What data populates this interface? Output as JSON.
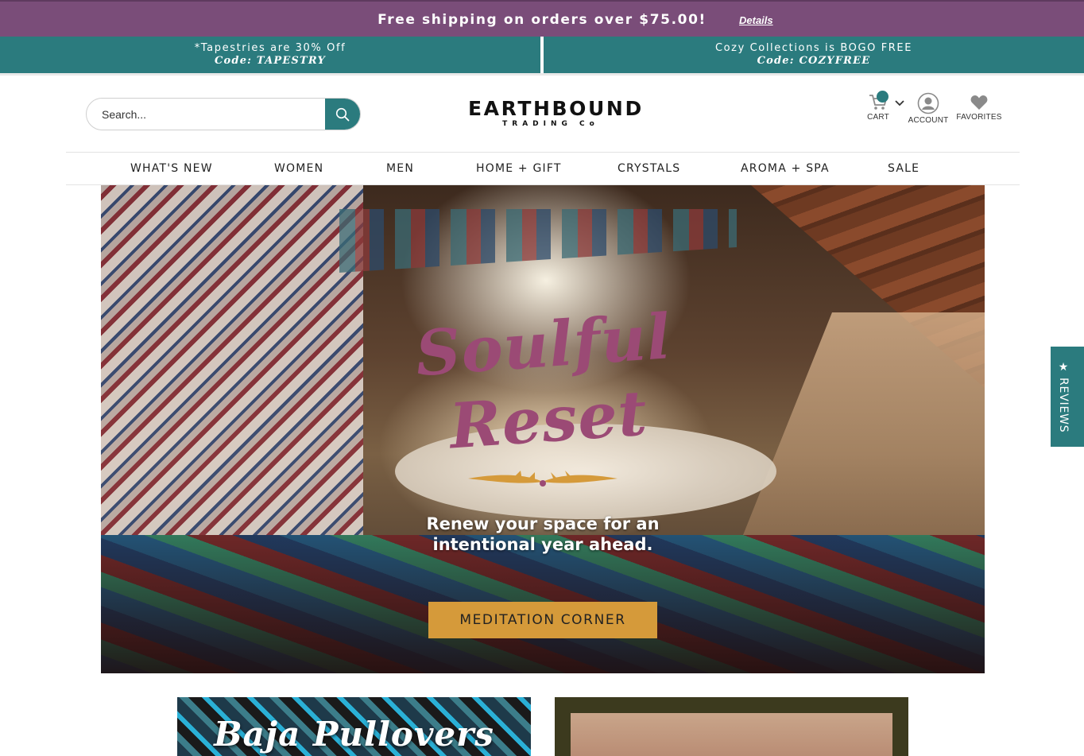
{
  "promo": {
    "text": "Free shipping on orders over $75.00!",
    "details_label": "Details"
  },
  "codes": [
    {
      "line1": "*Tapestries are 30% Off",
      "line2": "Code: TAPESTRY"
    },
    {
      "line1": "Cozy Collections is BOGO FREE",
      "line2": "Code: COZYFREE"
    }
  ],
  "search": {
    "placeholder": "Search...",
    "icon": "search-icon"
  },
  "logo": {
    "main": "EARTHBOUND",
    "sub": "TRADING Co"
  },
  "utility": {
    "cart_label": "CART",
    "account_label": "ACCOUNT",
    "favorites_label": "FAVORITES"
  },
  "nav": {
    "items": [
      "WHAT'S NEW",
      "WOMEN",
      "MEN",
      "HOME + GIFT",
      "CRYSTALS",
      "AROMA + SPA",
      "SALE"
    ]
  },
  "hero": {
    "title_line1": "Soulful",
    "title_line2": "Reset",
    "subtitle_line1": "Renew your space for an",
    "subtitle_line2": "intentional year ahead.",
    "cta_label": "MEDITATION CORNER"
  },
  "tiles": [
    {
      "title": "Baja Pullovers"
    },
    {
      "title": ""
    }
  ],
  "reviews_tab": {
    "label": "REVIEWS",
    "icon": "star-icon"
  },
  "colors": {
    "promo_purple": "#7a4d79",
    "teal": "#2b7b7e",
    "hero_title": "#9b4a75",
    "cta_gold": "#d59a3a"
  }
}
